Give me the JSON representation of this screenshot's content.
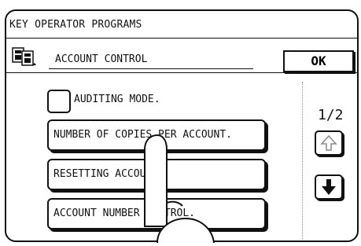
{
  "window": {
    "title": "KEY OPERATOR PROGRAMS"
  },
  "header": {
    "title": "ACCOUNT CONTROL",
    "ok_label": "OK"
  },
  "checkbox": {
    "label": "AUDITING MODE.",
    "checked": false
  },
  "menu": {
    "items": [
      {
        "label": "NUMBER OF COPIES PER ACCOUNT."
      },
      {
        "label": "RESETTING ACCOUNT."
      },
      {
        "label": "ACCOUNT NUMBER CONTROL."
      }
    ]
  },
  "pager": {
    "current": 1,
    "total": 2,
    "text": "1/2"
  },
  "icons": {
    "header": "account-control-icon",
    "scroll_up": "arrow-up-icon",
    "scroll_down": "arrow-down-icon",
    "pointer": "hand-pointer-icon"
  }
}
